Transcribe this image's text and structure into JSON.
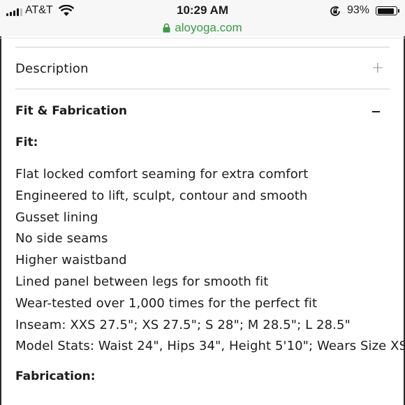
{
  "status_bar": {
    "carrier": "AT&T",
    "time": "10:29 AM",
    "battery_percent": "93%",
    "battery_level": 0.93,
    "icons": [
      "signal-bars-icon",
      "wifi-icon",
      "orientation-lock-icon",
      "battery-icon"
    ]
  },
  "browser": {
    "url": "aloyoga.com",
    "secure_icon": "lock-icon",
    "url_color": "#3a9a46"
  },
  "accordion": {
    "description": {
      "label": "Description",
      "toggle_symbol": "+"
    },
    "fit_fabrication": {
      "label": "Fit & Fabrication",
      "expanded": true
    }
  },
  "content": {
    "fit_heading": "Fit:",
    "fit_items": [
      "Flat locked comfort seaming for extra comfort",
      "Engineered to lift, sculpt, contour and smooth",
      "Gusset lining",
      "No side seams",
      "Higher waistband",
      "Lined panel between legs for smooth fit",
      "Wear-tested over 1,000 times for the perfect fit",
      "Inseam: XXS 27.5\"; XS 27.5\"; S 28\"; M 28.5\"; L 28.5\"",
      "Model Stats: Waist 24\", Hips 34\", Height 5'10\"; Wears Size XS"
    ],
    "fabrication_heading": "Fabrication:"
  }
}
